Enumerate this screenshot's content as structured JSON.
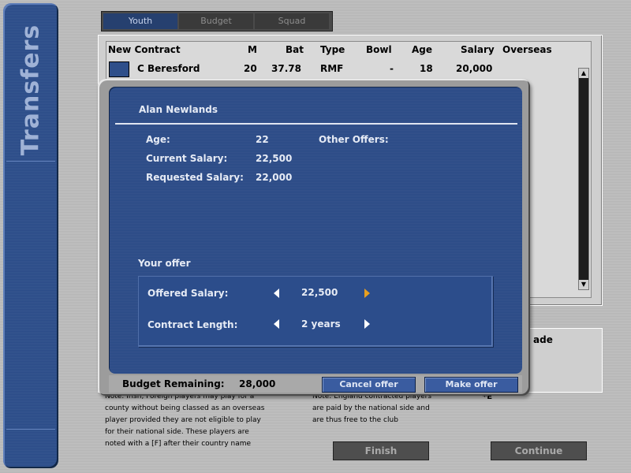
{
  "sidebar": {
    "title": "Transfers"
  },
  "tabs": [
    {
      "label": "Youth",
      "active": true
    },
    {
      "label": "Budget",
      "active": false
    },
    {
      "label": "Squad",
      "active": false
    }
  ],
  "list": {
    "columns": [
      "New Contract",
      "M",
      "Bat",
      "Type",
      "Bowl",
      "Age",
      "Salary",
      "Overseas"
    ],
    "rows": [
      {
        "name": "C Beresford",
        "m": "20",
        "bat": "37.78",
        "type": "RMF",
        "bowl": "-",
        "age": "18",
        "salary": "20,000",
        "overseas": ""
      }
    ]
  },
  "dialog": {
    "player_name": "Alan Newlands",
    "age_label": "Age:",
    "age_value": "22",
    "other_offers_label": "Other Offers:",
    "current_salary_label": "Current Salary:",
    "current_salary_value": "22,500",
    "requested_salary_label": "Requested Salary:",
    "requested_salary_value": "22,000",
    "your_offer_label": "Your offer",
    "offered_salary_label": "Offered Salary:",
    "offered_salary_value": "22,500",
    "contract_length_label": "Contract Length:",
    "contract_length_value": "2 years",
    "budget_label": "Budget Remaining:",
    "budget_value": "28,000",
    "cancel_label": "Cancel offer",
    "make_label": "Make offer"
  },
  "lower": {
    "trade_label": "ade",
    "note_left": [
      "Note: Irish, Foreign players may play for a",
      "county without being classed as an overseas",
      "player provided they are not eligible to play",
      "for their national side. These players are",
      "noted with a [F] after their country name"
    ],
    "note_right": [
      "Note: England contracted players",
      "are paid by the national side and",
      "are thus free to the club"
    ],
    "star": "*E"
  },
  "footer": {
    "finish_label": "Finish",
    "continue_label": "Continue"
  },
  "colors": {
    "panel_blue": "#2a4a86",
    "highlight_arrow": "#e8a020"
  }
}
